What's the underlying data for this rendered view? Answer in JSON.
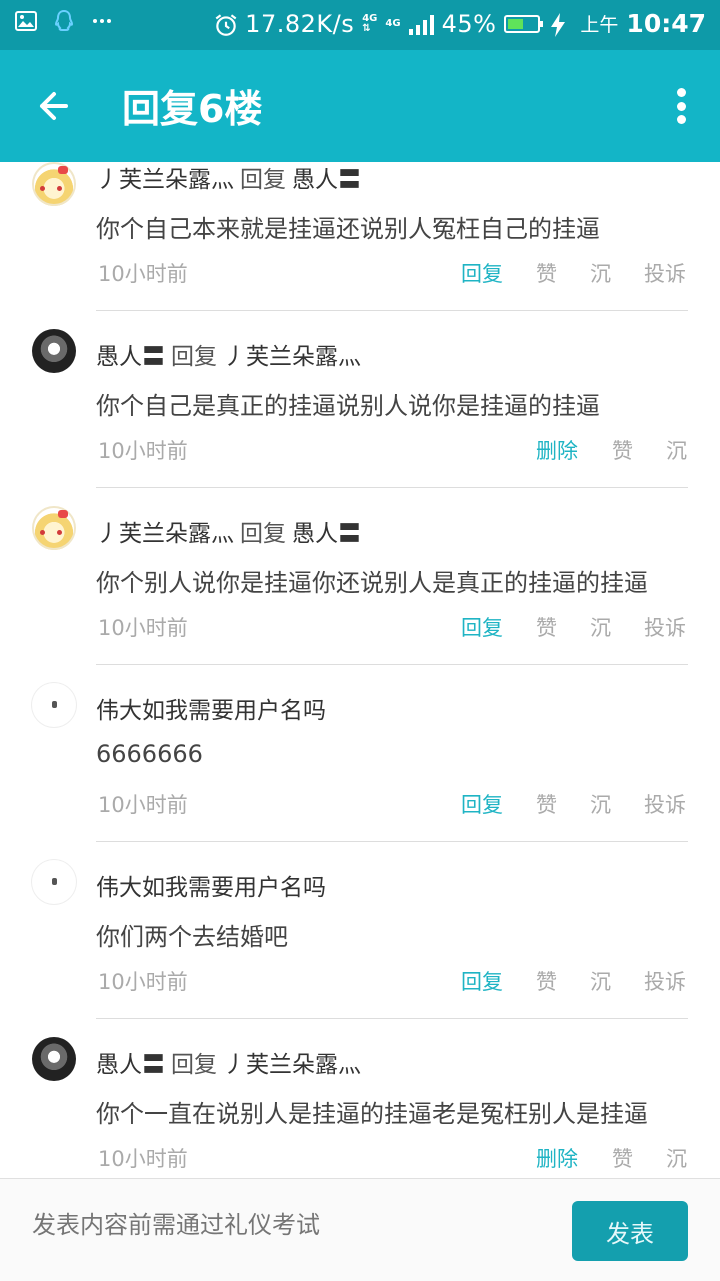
{
  "status_bar": {
    "network_speed": "17.82K/s",
    "net_type_1": "4G",
    "net_type_2": "4G",
    "battery": "45%",
    "ampm": "上午",
    "time": "10:47"
  },
  "app_bar": {
    "title": "回复6楼"
  },
  "replies": [
    {
      "author": "丿芙兰朵露灬",
      "reply_label": "回复",
      "target": "愚人〓",
      "content": "你个自己本来就是挂逼还说别人冤枉自己的挂逼",
      "time": "10小时前",
      "actions": [
        "回复",
        "赞",
        "沉",
        "投诉"
      ],
      "avatar": "anime-girl-avatar"
    },
    {
      "author": "愚人〓",
      "reply_label": "回复",
      "target": "丿芙兰朵露灬",
      "content": "你个自己是真正的挂逼说别人说你是挂逼的挂逼",
      "time": "10小时前",
      "actions": [
        "删除",
        "赞",
        "沉"
      ],
      "avatar": "dark-photo-avatar"
    },
    {
      "author": "丿芙兰朵露灬",
      "reply_label": "回复",
      "target": "愚人〓",
      "content": "你个别人说你是挂逼你还说别人是真正的挂逼的挂逼",
      "time": "10小时前",
      "actions": [
        "回复",
        "赞",
        "沉",
        "投诉"
      ],
      "avatar": "anime-girl-avatar"
    },
    {
      "author": "伟大如我需要用户名吗",
      "reply_label": "",
      "target": "",
      "content": "6666666",
      "time": "10小时前",
      "actions": [
        "回复",
        "赞",
        "沉",
        "投诉"
      ],
      "avatar": "white-avatar"
    },
    {
      "author": "伟大如我需要用户名吗",
      "reply_label": "",
      "target": "",
      "content": "你们两个去结婚吧",
      "time": "10小时前",
      "actions": [
        "回复",
        "赞",
        "沉",
        "投诉"
      ],
      "avatar": "white-avatar"
    },
    {
      "author": "愚人〓",
      "reply_label": "回复",
      "target": "丿芙兰朵露灬",
      "content": "你个一直在说别人是挂逼的挂逼老是冤枉别人是挂逼",
      "time": "10小时前",
      "actions": [
        "删除",
        "赞",
        "沉"
      ],
      "avatar": "dark-photo-avatar"
    }
  ],
  "composer": {
    "placeholder": "发表内容前需通过礼仪考试",
    "send_label": "发表"
  },
  "colors": {
    "appbar": "#13b5c7",
    "statusbar": "#0e9aa8",
    "accent": "#1fb4c4",
    "send_button": "#149fae"
  }
}
